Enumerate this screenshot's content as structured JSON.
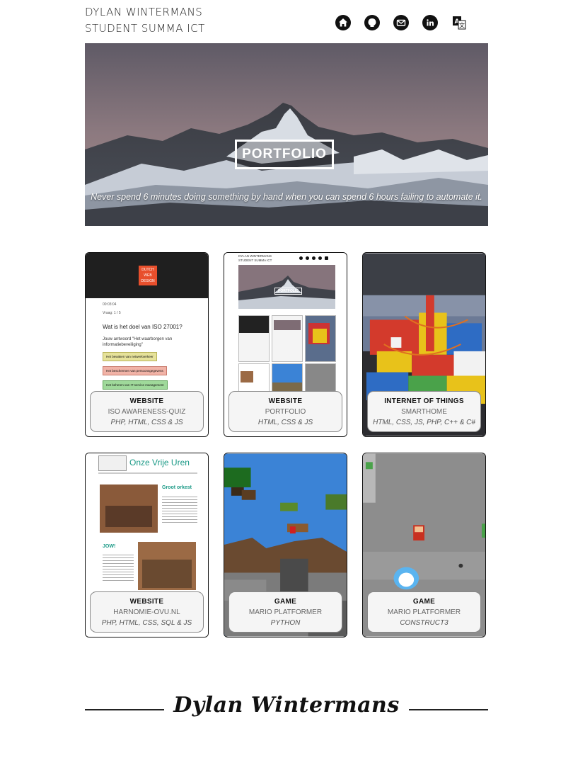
{
  "header": {
    "name": "DYLAN WINTERMANS",
    "subtitle": "STUDENT SUMMA ICT",
    "icons": [
      "home-icon",
      "github-icon",
      "mail-icon",
      "linkedin-icon",
      "translate-icon"
    ]
  },
  "hero": {
    "button_label": "PORTFOLIO",
    "quote": "Never spend 6 minutes doing something by hand when you can spend 6 hours failing to automate it."
  },
  "projects": [
    {
      "category": "WEBSITE",
      "name": "ISO AWARENESS-QUIZ",
      "tech": "PHP, HTML, CSS & JS",
      "preview": {
        "logo": [
          "DUTCH",
          "WEB",
          "DESIGN"
        ],
        "timer": "00:03:04",
        "step": "Vraag: 1 / 5",
        "question": "Wat is het doel van ISO 27001?",
        "answer_line1": "Jouw antwoord \"Het waarborgen van",
        "answer_line2": "informatiebeveiliging\"",
        "options": [
          "Het bewaken van netwerkverkeer",
          "Het beschermen van persoonsgegevens",
          "Het beheren van IT-service management"
        ]
      }
    },
    {
      "category": "WEBSITE",
      "name": "PORTFOLIO",
      "tech": "HTML, CSS & JS",
      "preview": {
        "line1": "DYLAN WINTERMANS",
        "line2": "STUDENT SUMMA ICT",
        "button": "PORTFOLIO"
      }
    },
    {
      "category": "INTERNET OF THINGS",
      "name": "SMARTHOME",
      "tech": "HTML, CSS, JS, PHP, C++ & C#"
    },
    {
      "category": "WEBSITE",
      "name": "HARNOMIE-OVU.NL",
      "tech": "PHP, HTML, CSS, SQL & JS",
      "preview": {
        "site_title": "Onze Vrije Uren",
        "heading1": "Groot orkest",
        "heading2": "JOW!"
      }
    },
    {
      "category": "GAME",
      "name": "MARIO PLATFORMER",
      "tech": "PYTHON"
    },
    {
      "category": "GAME",
      "name": "MARIO PLATFORMER",
      "tech": "CONSTRUCT3"
    }
  ],
  "footer": {
    "signature": "Dylan Wintermans"
  }
}
